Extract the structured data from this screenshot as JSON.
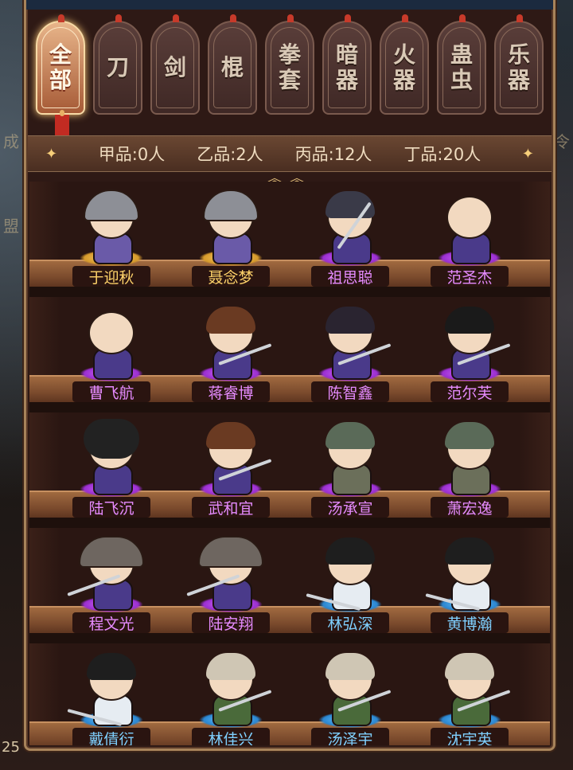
{
  "tabs": [
    {
      "label": "全部",
      "active": true
    },
    {
      "label": "刀",
      "active": false
    },
    {
      "label": "剑",
      "active": false
    },
    {
      "label": "棍",
      "active": false
    },
    {
      "label": "拳套",
      "active": false
    },
    {
      "label": "暗器",
      "active": false
    },
    {
      "label": "火器",
      "active": false
    },
    {
      "label": "蛊虫",
      "active": false
    },
    {
      "label": "乐器",
      "active": false
    }
  ],
  "quality_counts": {
    "jia": "甲品:0人",
    "yi": "乙品:2人",
    "bing": "丙品:12人",
    "ding": "丁品:20人"
  },
  "heroes": [
    {
      "name": "于迎秋",
      "rarity": "gold",
      "look": "helm"
    },
    {
      "name": "聂念梦",
      "rarity": "gold",
      "look": "helm"
    },
    {
      "name": "祖思聪",
      "rarity": "purple",
      "look": "spear"
    },
    {
      "name": "范圣杰",
      "rarity": "purple",
      "look": "bald"
    },
    {
      "name": "曹飞航",
      "rarity": "purple",
      "look": "bald"
    },
    {
      "name": "蒋睿博",
      "rarity": "purple",
      "look": "brown"
    },
    {
      "name": "陈智鑫",
      "rarity": "purple",
      "look": "topknot"
    },
    {
      "name": "范尔芙",
      "rarity": "purple",
      "look": "longhair"
    },
    {
      "name": "陆飞沉",
      "rarity": "purple",
      "look": "hood"
    },
    {
      "name": "武和宜",
      "rarity": "purple",
      "look": "brown"
    },
    {
      "name": "汤承宣",
      "rarity": "purple",
      "look": "cap"
    },
    {
      "name": "萧宏逸",
      "rarity": "purple",
      "look": "cap"
    },
    {
      "name": "程文光",
      "rarity": "purple",
      "look": "soldier"
    },
    {
      "name": "陆安翔",
      "rarity": "purple",
      "look": "soldier"
    },
    {
      "name": "林弘深",
      "rarity": "blue",
      "look": "bun"
    },
    {
      "name": "黄博瀚",
      "rarity": "blue",
      "look": "bun"
    },
    {
      "name": "戴倩衍",
      "rarity": "blue",
      "look": "bun"
    },
    {
      "name": "林佳兴",
      "rarity": "blue",
      "look": "spiky"
    },
    {
      "name": "汤泽宇",
      "rarity": "blue",
      "look": "spiky"
    },
    {
      "name": "沈宇英",
      "rarity": "blue",
      "look": "spiky"
    }
  ],
  "side": {
    "left_badge": "25"
  }
}
